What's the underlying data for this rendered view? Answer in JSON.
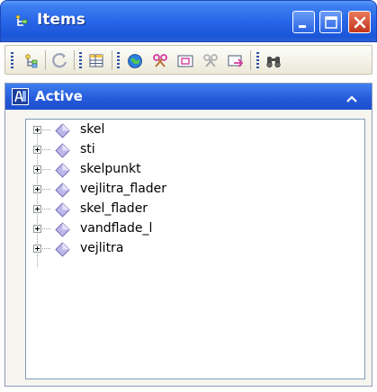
{
  "window": {
    "title": "Items",
    "buttons": {
      "minimize_icon": "minimize-icon",
      "maximize_icon": "maximize-icon",
      "close_icon": "close-icon"
    }
  },
  "toolbar": {
    "buttons": [
      {
        "icon": "item-tree-icon"
      },
      {
        "icon": "refresh-icon"
      },
      {
        "icon": "table-view-icon"
      },
      {
        "icon": "globe-icon"
      },
      {
        "icon": "scissors-icon"
      },
      {
        "icon": "frame-icon"
      },
      {
        "icon": "scissors-gray-icon"
      },
      {
        "icon": "export-icon"
      },
      {
        "icon": "binoculars-icon"
      }
    ]
  },
  "panel": {
    "title": "Active",
    "collapse_icon": "chevron-up-icon"
  },
  "tree": {
    "items": [
      {
        "label": "skel"
      },
      {
        "label": "sti"
      },
      {
        "label": "skelpunkt"
      },
      {
        "label": "vejlitra_flader"
      },
      {
        "label": "skel_flader"
      },
      {
        "label": "vandflade_l"
      },
      {
        "label": "vejlitra"
      }
    ]
  },
  "colors": {
    "titlebar": "#2663e6",
    "close_button": "#c2351b",
    "panel_header": "#2459d9",
    "item_icon": "#b9b4e6"
  }
}
